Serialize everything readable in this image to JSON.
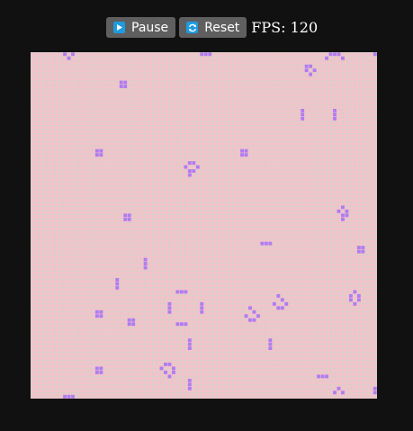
{
  "toolbar": {
    "pause_label": "Pause",
    "reset_label": "Reset",
    "fps_label": "FPS: 120"
  },
  "icons": {
    "pause": "play-icon",
    "reset": "refresh-icon"
  },
  "colors": {
    "background": "#111111",
    "board": "#f4c2cc",
    "grid_line": "#c8d7c3",
    "live_cell": "#b07cf0",
    "button": "#5f5f5f",
    "icon_badge": "#1e9be0"
  },
  "board": {
    "columns": 86,
    "rows": 86,
    "live_cells": [
      [
        8,
        0
      ],
      [
        10,
        0
      ],
      [
        9,
        1
      ],
      [
        42,
        0
      ],
      [
        43,
        0
      ],
      [
        44,
        0
      ],
      [
        74,
        0
      ],
      [
        75,
        0
      ],
      [
        76,
        0
      ],
      [
        73,
        1
      ],
      [
        77,
        1
      ],
      [
        85,
        0
      ],
      [
        68,
        3
      ],
      [
        69,
        3
      ],
      [
        68,
        4
      ],
      [
        70,
        4
      ],
      [
        69,
        5
      ],
      [
        22,
        7
      ],
      [
        23,
        7
      ],
      [
        22,
        8
      ],
      [
        23,
        8
      ],
      [
        67,
        14
      ],
      [
        67,
        15
      ],
      [
        67,
        16
      ],
      [
        75,
        14
      ],
      [
        75,
        15
      ],
      [
        75,
        16
      ],
      [
        16,
        24
      ],
      [
        17,
        24
      ],
      [
        16,
        25
      ],
      [
        17,
        25
      ],
      [
        52,
        24
      ],
      [
        53,
        24
      ],
      [
        52,
        25
      ],
      [
        53,
        25
      ],
      [
        39,
        27
      ],
      [
        40,
        27
      ],
      [
        38,
        28
      ],
      [
        41,
        28
      ],
      [
        39,
        29
      ],
      [
        40,
        29
      ],
      [
        39,
        30
      ],
      [
        77,
        38
      ],
      [
        76,
        39
      ],
      [
        78,
        39
      ],
      [
        77,
        40
      ],
      [
        78,
        40
      ],
      [
        77,
        41
      ],
      [
        23,
        40
      ],
      [
        24,
        40
      ],
      [
        23,
        41
      ],
      [
        24,
        41
      ],
      [
        57,
        47
      ],
      [
        58,
        47
      ],
      [
        59,
        47
      ],
      [
        81,
        48
      ],
      [
        82,
        48
      ],
      [
        81,
        49
      ],
      [
        82,
        49
      ],
      [
        28,
        51
      ],
      [
        28,
        52
      ],
      [
        28,
        53
      ],
      [
        21,
        56
      ],
      [
        21,
        57
      ],
      [
        21,
        58
      ],
      [
        36,
        59
      ],
      [
        37,
        59
      ],
      [
        38,
        59
      ],
      [
        80,
        59
      ],
      [
        79,
        60
      ],
      [
        81,
        60
      ],
      [
        79,
        61
      ],
      [
        81,
        61
      ],
      [
        80,
        62
      ],
      [
        61,
        60
      ],
      [
        62,
        61
      ],
      [
        60,
        62
      ],
      [
        63,
        62
      ],
      [
        61,
        63
      ],
      [
        62,
        63
      ],
      [
        34,
        62
      ],
      [
        34,
        63
      ],
      [
        34,
        64
      ],
      [
        42,
        62
      ],
      [
        42,
        63
      ],
      [
        42,
        64
      ],
      [
        54,
        63
      ],
      [
        55,
        64
      ],
      [
        53,
        65
      ],
      [
        56,
        65
      ],
      [
        54,
        66
      ],
      [
        55,
        66
      ],
      [
        16,
        64
      ],
      [
        17,
        64
      ],
      [
        16,
        65
      ],
      [
        17,
        65
      ],
      [
        24,
        66
      ],
      [
        25,
        66
      ],
      [
        24,
        67
      ],
      [
        25,
        67
      ],
      [
        36,
        67
      ],
      [
        37,
        67
      ],
      [
        38,
        67
      ],
      [
        39,
        71
      ],
      [
        39,
        72
      ],
      [
        39,
        73
      ],
      [
        59,
        71
      ],
      [
        59,
        72
      ],
      [
        59,
        73
      ],
      [
        33,
        77
      ],
      [
        34,
        77
      ],
      [
        32,
        78
      ],
      [
        35,
        78
      ],
      [
        33,
        79
      ],
      [
        35,
        79
      ],
      [
        34,
        80
      ],
      [
        16,
        78
      ],
      [
        17,
        78
      ],
      [
        16,
        79
      ],
      [
        17,
        79
      ],
      [
        71,
        80
      ],
      [
        72,
        80
      ],
      [
        73,
        80
      ],
      [
        39,
        81
      ],
      [
        39,
        82
      ],
      [
        39,
        83
      ],
      [
        76,
        83
      ],
      [
        75,
        84
      ],
      [
        77,
        84
      ],
      [
        85,
        83
      ],
      [
        85,
        84
      ],
      [
        8,
        85
      ],
      [
        9,
        85
      ],
      [
        10,
        85
      ]
    ]
  }
}
